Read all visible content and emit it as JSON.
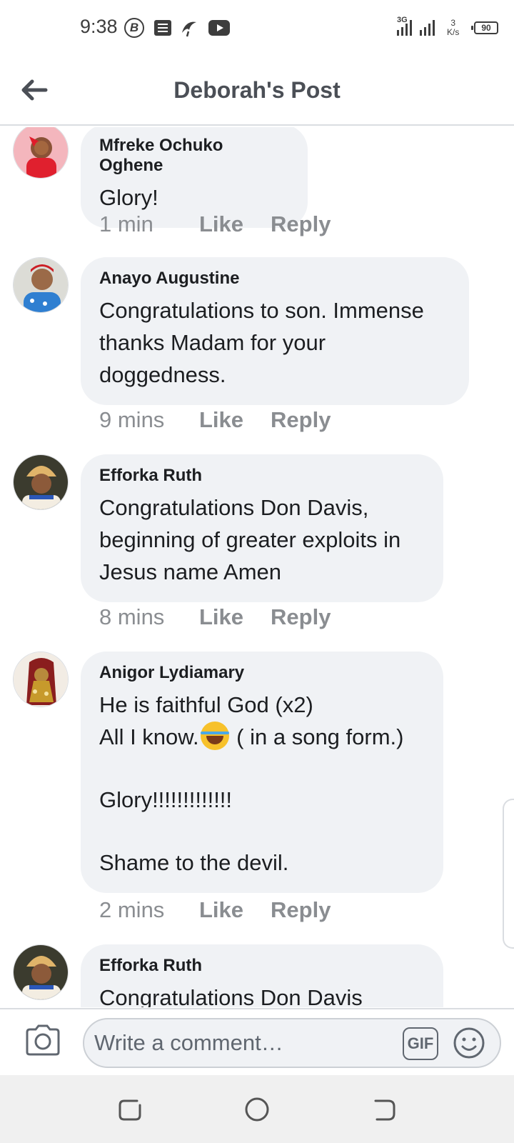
{
  "status_bar": {
    "time": "9:38",
    "network": "3G",
    "speed_value": "3",
    "speed_unit": "K/s",
    "battery": "90",
    "icons": [
      "b-badge-icon",
      "news-icon",
      "bird-icon",
      "youtube-icon",
      "signal-icon",
      "signal-icon"
    ]
  },
  "header": {
    "title": "Deborah's Post",
    "back_icon": "arrow-left-icon"
  },
  "comments": [
    {
      "author": "Mfreke Ochuko Oghene",
      "text": "Glory!",
      "time": "1 min",
      "like": "Like",
      "reply": "Reply"
    },
    {
      "author": "Anayo Augustine",
      "text": "Congratulations to son. Immense thanks Madam for your doggedness.",
      "time": "9 mins",
      "like": "Like",
      "reply": "Reply"
    },
    {
      "author": "Efforka Ruth",
      "text": "Congratulations Don Davis, beginning of greater exploits in Jesus name Amen",
      "time": "8 mins",
      "like": "Like",
      "reply": "Reply"
    },
    {
      "author": "Anigor Lydiamary",
      "text_line1": "He is faithful God (x2)",
      "text_line2_a": "All I know.",
      "text_line2_b": " ( in a song form.)",
      "text_line3": "Glory!!!!!!!!!!!!!",
      "text_line4": "Shame to the devil.",
      "emoji": "laughing-crying-emoji",
      "time": "2 mins",
      "like": "Like",
      "reply": "Reply"
    },
    {
      "author": "Efforka Ruth",
      "text": "Congratulations Don Davis"
    }
  ],
  "composer": {
    "placeholder": "Write a comment…",
    "gif_label": "GIF",
    "camera_icon": "camera-icon",
    "emoji_icon": "smiley-icon"
  },
  "navbar": {
    "icons": [
      "recent-apps-icon",
      "home-icon",
      "back-nav-icon"
    ]
  },
  "colors": {
    "bubble": "#f0f2f5",
    "meta_text": "#8a8d91",
    "title_text": "#4b4f56"
  }
}
